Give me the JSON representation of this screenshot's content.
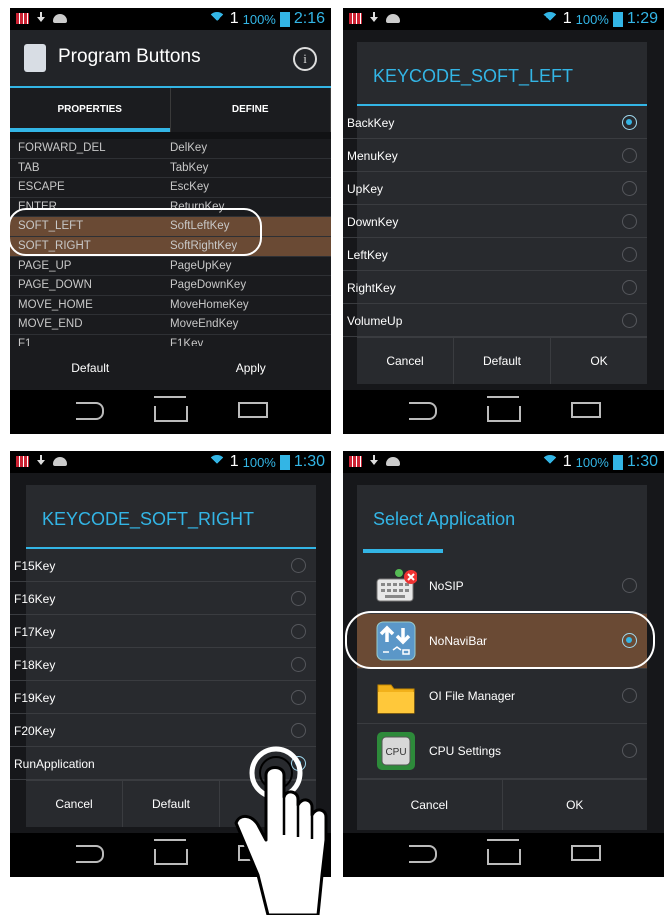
{
  "status": {
    "signal": "1",
    "battery": "100%",
    "times": [
      "2:16",
      "1:29",
      "1:30",
      "1:30"
    ]
  },
  "panel1": {
    "title": "Program Buttons",
    "info": "i",
    "tabs": [
      "PROPERTIES",
      "DEFINE"
    ],
    "rows": [
      {
        "key": "FORWARD_DEL",
        "value": "DelKey"
      },
      {
        "key": "TAB",
        "value": "TabKey"
      },
      {
        "key": "ESCAPE",
        "value": "EscKey"
      },
      {
        "key": "ENTER",
        "value": "ReturnKey"
      },
      {
        "key": "SOFT_LEFT",
        "value": "SoftLeftKey"
      },
      {
        "key": "SOFT_RIGHT",
        "value": "SoftRightKey"
      },
      {
        "key": "PAGE_UP",
        "value": "PageUpKey"
      },
      {
        "key": "PAGE_DOWN",
        "value": "PageDownKey"
      },
      {
        "key": "MOVE_HOME",
        "value": "MoveHomeKey"
      },
      {
        "key": "MOVE_END",
        "value": "MoveEndKey"
      },
      {
        "key": "F1",
        "value": "F1Key"
      }
    ],
    "buttons": [
      "Default",
      "Apply"
    ]
  },
  "panel2": {
    "title": "KEYCODE_SOFT_LEFT",
    "options": [
      "BackKey",
      "MenuKey",
      "UpKey",
      "DownKey",
      "LeftKey",
      "RightKey",
      "VolumeUp"
    ],
    "selected": "BackKey",
    "buttons": [
      "Cancel",
      "Default",
      "OK"
    ]
  },
  "panel3": {
    "title": "KEYCODE_SOFT_RIGHT",
    "options": [
      "F15Key",
      "F16Key",
      "F17Key",
      "F18Key",
      "F19Key",
      "F20Key",
      "RunApplication"
    ],
    "selected": "RunApplication",
    "buttons": [
      "Cancel",
      "Default"
    ]
  },
  "panel4": {
    "title": "Select Application",
    "options": [
      {
        "label": "NoSIP",
        "icon": "keyboard-icon"
      },
      {
        "label": "NoNaviBar",
        "icon": "navibar-icon"
      },
      {
        "label": "OI File Manager",
        "icon": "folder-icon"
      },
      {
        "label": "CPU Settings",
        "icon": "cpu-icon"
      }
    ],
    "selected": "NoNaviBar",
    "buttons": [
      "Cancel",
      "OK"
    ],
    "cpu_text": "CPU"
  },
  "colors": {
    "accent": "#33b5e5",
    "highlight": "#6a4a34"
  }
}
